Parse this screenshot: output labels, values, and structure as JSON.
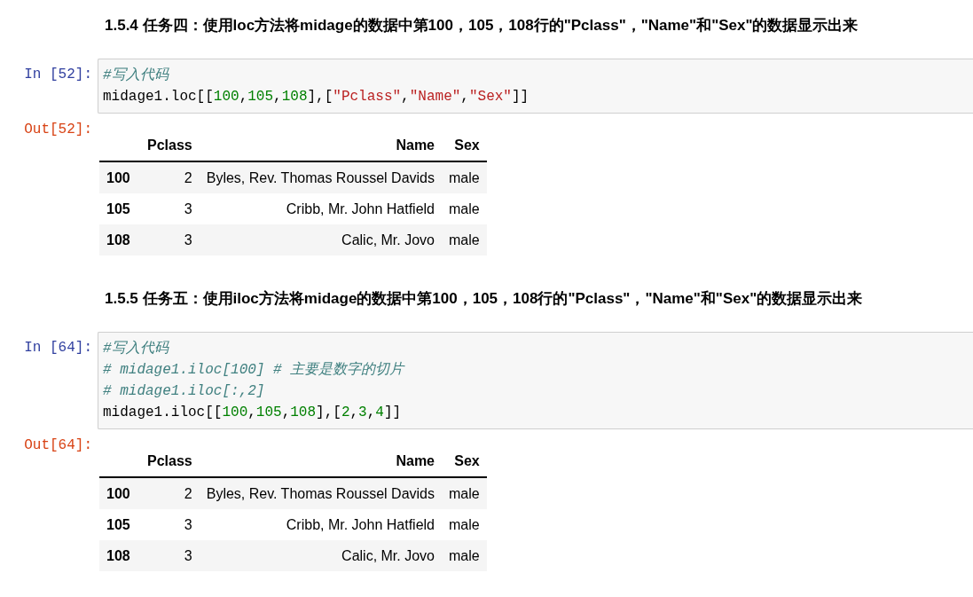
{
  "sections": [
    {
      "heading": "1.5.4 任务四：使用loc方法将midage的数据中第100，105，108行的\"Pclass\"，\"Name\"和\"Sex\"的数据显示出来",
      "input": {
        "prompt": "In [52]:",
        "lines": [
          [
            {
              "kind": "comment",
              "text": "#写入代码"
            }
          ],
          [
            {
              "kind": "plain",
              "text": "midage1.loc[["
            },
            {
              "kind": "number",
              "text": "100"
            },
            {
              "kind": "plain",
              "text": ","
            },
            {
              "kind": "number",
              "text": "105"
            },
            {
              "kind": "plain",
              "text": ","
            },
            {
              "kind": "number",
              "text": "108"
            },
            {
              "kind": "plain",
              "text": "],["
            },
            {
              "kind": "string",
              "text": "\"Pclass\""
            },
            {
              "kind": "plain",
              "text": ","
            },
            {
              "kind": "string",
              "text": "\"Name\""
            },
            {
              "kind": "plain",
              "text": ","
            },
            {
              "kind": "string",
              "text": "\"Sex\""
            },
            {
              "kind": "plain",
              "text": "]]"
            }
          ]
        ]
      },
      "output": {
        "prompt": "Out[52]:",
        "table": {
          "columns": [
            "Pclass",
            "Name",
            "Sex"
          ],
          "rows": [
            {
              "index": "100",
              "cells": [
                "2",
                "Byles, Rev. Thomas Roussel Davids",
                "male"
              ]
            },
            {
              "index": "105",
              "cells": [
                "3",
                "Cribb, Mr. John Hatfield",
                "male"
              ]
            },
            {
              "index": "108",
              "cells": [
                "3",
                "Calic, Mr. Jovo",
                "male"
              ]
            }
          ]
        }
      }
    },
    {
      "heading": "1.5.5 任务五：使用iloc方法将midage的数据中第100，105，108行的\"Pclass\"，\"Name\"和\"Sex\"的数据显示出来",
      "input": {
        "prompt": "In [64]:",
        "lines": [
          [
            {
              "kind": "comment",
              "text": "#写入代码"
            }
          ],
          [
            {
              "kind": "comment",
              "text": "# midage1.iloc[100] # 主要是数字的切片"
            }
          ],
          [
            {
              "kind": "comment",
              "text": "# midage1.iloc[:,2]"
            }
          ],
          [
            {
              "kind": "plain",
              "text": "midage1.iloc[["
            },
            {
              "kind": "number",
              "text": "100"
            },
            {
              "kind": "plain",
              "text": ","
            },
            {
              "kind": "number",
              "text": "105"
            },
            {
              "kind": "plain",
              "text": ","
            },
            {
              "kind": "number",
              "text": "108"
            },
            {
              "kind": "plain",
              "text": "],["
            },
            {
              "kind": "number",
              "text": "2"
            },
            {
              "kind": "plain",
              "text": ","
            },
            {
              "kind": "number",
              "text": "3"
            },
            {
              "kind": "plain",
              "text": ","
            },
            {
              "kind": "number",
              "text": "4"
            },
            {
              "kind": "plain",
              "text": "]]"
            }
          ]
        ]
      },
      "output": {
        "prompt": "Out[64]:",
        "table": {
          "columns": [
            "Pclass",
            "Name",
            "Sex"
          ],
          "rows": [
            {
              "index": "100",
              "cells": [
                "2",
                "Byles, Rev. Thomas Roussel Davids",
                "male"
              ]
            },
            {
              "index": "105",
              "cells": [
                "3",
                "Cribb, Mr. John Hatfield",
                "male"
              ]
            },
            {
              "index": "108",
              "cells": [
                "3",
                "Calic, Mr. Jovo",
                "male"
              ]
            }
          ]
        }
      }
    }
  ]
}
